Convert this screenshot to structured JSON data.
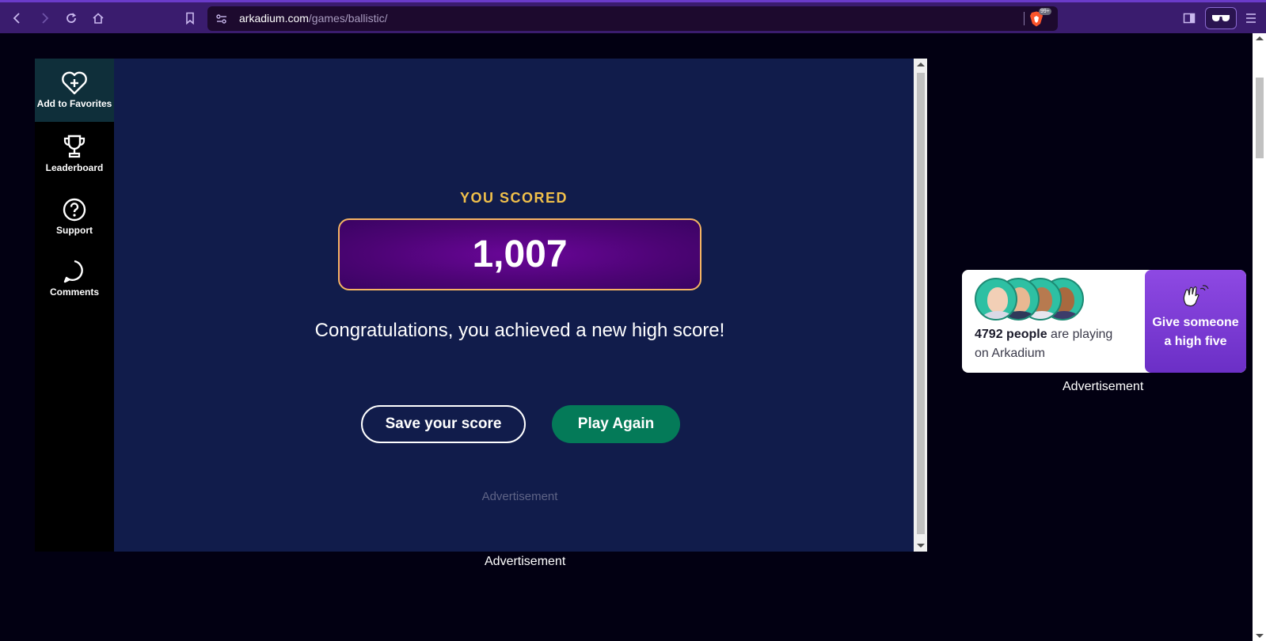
{
  "browser": {
    "url_domain": "arkadium.com",
    "url_path": "/games/ballistic/",
    "badge": "99+"
  },
  "rail": {
    "items": [
      {
        "label": "Add to Favorites",
        "icon": "heart-plus-icon"
      },
      {
        "label": "Leaderboard",
        "icon": "trophy-icon"
      },
      {
        "label": "Support",
        "icon": "question-circle-icon"
      },
      {
        "label": "Comments",
        "icon": "speech-bubble-icon"
      }
    ]
  },
  "game": {
    "you_scored": "YOU SCORED",
    "score": "1,007",
    "congrats": "Congratulations, you achieved a new high score!",
    "save_label": "Save your score",
    "play_label": "Play Again",
    "ad_label": "Advertisement"
  },
  "ad_below": "Advertisement",
  "social": {
    "count": "4792 people",
    "text_rest": " are playing",
    "text_line2": "on Arkadium",
    "highfive_line1": "Give someone",
    "highfive_line2": "a high five"
  },
  "ad_right": "Advertisement",
  "colors": {
    "accent_gold": "#f1c04b",
    "play_green": "#047a58",
    "highfive_purple": "#8e49e3"
  }
}
